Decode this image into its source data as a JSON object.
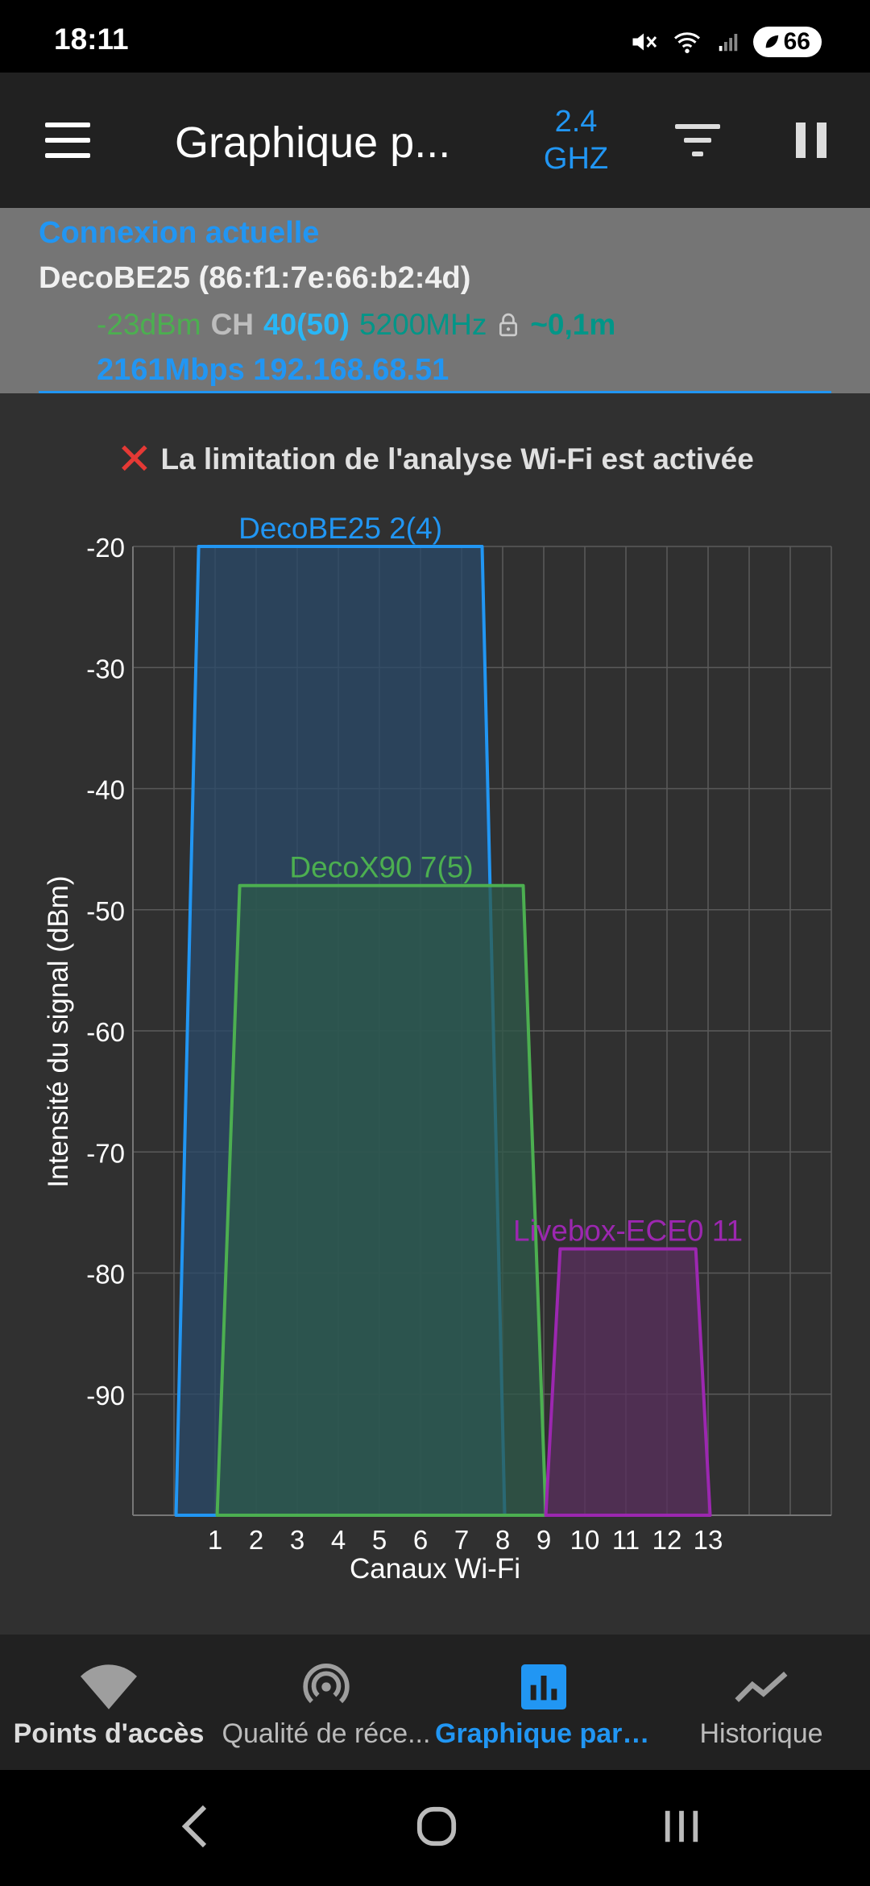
{
  "status_bar": {
    "time": "18:11",
    "battery": "66"
  },
  "app_bar": {
    "title": "Graphique p...",
    "band_line1": "2.4",
    "band_line2": "GHZ"
  },
  "connection": {
    "heading": "Connexion actuelle",
    "ssid_bssid": "DecoBE25 (86:f1:7e:66:b2:4d)",
    "signal": "-23dBm",
    "ch_label": "CH",
    "channel": "40(50)",
    "frequency": "5200MHz",
    "distance": "~0,1m",
    "speed_ip": "2161Mbps 192.168.68.51"
  },
  "warning": {
    "text": "La limitation de l'analyse Wi-Fi est activée"
  },
  "chart_data": {
    "type": "area",
    "xlabel": "Canaux Wi-Fi",
    "ylabel": "Intensité du signal (dBm)",
    "x_tick_labels": [
      "1",
      "2",
      "3",
      "4",
      "5",
      "6",
      "7",
      "8",
      "9",
      "10",
      "11",
      "12",
      "13"
    ],
    "y_ticks": [
      -20,
      -30,
      -40,
      -50,
      -60,
      -70,
      -80,
      -90
    ],
    "xlim": [
      -2,
      15
    ],
    "ylim": [
      -100,
      -20
    ],
    "series": [
      {
        "name": "DecoBE25 2(4)",
        "color": "#2196f3",
        "fill": "#2a4a6a",
        "points": [
          [
            -0.95,
            -100
          ],
          [
            -0.4,
            -20
          ],
          [
            6.5,
            -20
          ],
          [
            7.05,
            -100
          ]
        ]
      },
      {
        "name": "DecoX90 7(5)",
        "color": "#4caf50",
        "fill": "#2e5a4a",
        "points": [
          [
            0.05,
            -100
          ],
          [
            0.6,
            -48
          ],
          [
            7.5,
            -48
          ],
          [
            8.05,
            -100
          ]
        ]
      },
      {
        "name": "Livebox-ECE0 11",
        "color": "#9c27b0",
        "fill": "#5a2f5e",
        "points": [
          [
            8.05,
            -100
          ],
          [
            8.4,
            -78
          ],
          [
            11.7,
            -78
          ],
          [
            12.05,
            -100
          ]
        ]
      }
    ]
  },
  "bottom_nav": {
    "items": [
      {
        "label": "Points d'accès",
        "icon": "wifi-icon"
      },
      {
        "label": "Qualité de réce...",
        "icon": "signal-quality-icon"
      },
      {
        "label": "Graphique par ...",
        "icon": "bar-chart-icon"
      },
      {
        "label": "Historique",
        "icon": "history-line-icon"
      }
    ]
  }
}
